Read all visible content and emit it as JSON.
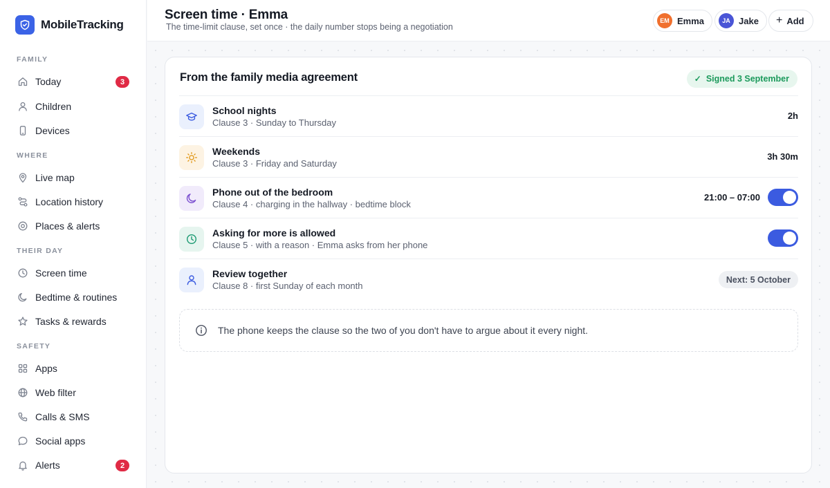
{
  "brand": {
    "name": "MobileTracking"
  },
  "sidebar": {
    "sections": [
      {
        "label": "FAMILY"
      },
      {
        "label": "WHERE"
      },
      {
        "label": "THEIR DAY"
      },
      {
        "label": "SAFETY"
      }
    ],
    "items": [
      {
        "label": "Today",
        "icon": "home-icon",
        "badge": "3"
      },
      {
        "label": "Children",
        "icon": "person-icon"
      },
      {
        "label": "Devices",
        "icon": "phone-icon"
      },
      {
        "label": "Live map",
        "icon": "map-pin-icon"
      },
      {
        "label": "Location history",
        "icon": "route-icon"
      },
      {
        "label": "Places & alerts",
        "icon": "target-icon"
      },
      {
        "label": "Screen time",
        "icon": "clock-icon"
      },
      {
        "label": "Bedtime & routines",
        "icon": "moon-icon"
      },
      {
        "label": "Tasks & rewards",
        "icon": "star-icon"
      },
      {
        "label": "Apps",
        "icon": "grid-icon"
      },
      {
        "label": "Web filter",
        "icon": "globe-icon"
      },
      {
        "label": "Calls & SMS",
        "icon": "phone-call-icon"
      },
      {
        "label": "Social apps",
        "icon": "chat-bubble-icon"
      },
      {
        "label": "Alerts",
        "icon": "bell-icon",
        "badge": "2"
      }
    ]
  },
  "header": {
    "title": "Screen time · Emma",
    "subtitle": "The time-limit clause, set once · the daily number stops being a negotiation",
    "children": [
      {
        "initials": "EM",
        "name": "Emma",
        "color": "#f0702e"
      },
      {
        "initials": "JA",
        "name": "Jake",
        "color": "#4a55d6"
      }
    ],
    "add_label": "Add"
  },
  "card": {
    "title": "From the family media agreement",
    "signed_label": "Signed 3 September",
    "rows": [
      {
        "title": "School nights",
        "sub": "Clause 3 · Sunday to Thursday",
        "value": "2h",
        "icon": "graduation-cap-icon"
      },
      {
        "title": "Weekends",
        "sub": "Clause 3 · Friday and Saturday",
        "value": "3h 30m",
        "icon": "sun-icon"
      },
      {
        "title": "Phone out of the bedroom",
        "sub": "Clause 4 · charging in the hallway · bedtime block",
        "time": "21:00 – 07:00",
        "toggle_on": true,
        "icon": "moon-icon"
      },
      {
        "title": "Asking for more is allowed",
        "sub": "Clause 5 · with a reason · Emma asks from her phone",
        "toggle_on": true,
        "icon": "clock-icon"
      },
      {
        "title": "Review together",
        "sub": "Clause 8 · first Sunday of each month",
        "next": "Next: 5 October",
        "icon": "person-icon"
      }
    ],
    "note": "The phone keeps the clause so the two of you don't have to argue about it every night."
  },
  "colors": {
    "accent": "#3b5be0",
    "brand": "#3b63e6",
    "badge": "#e02a45",
    "success": "#1c9a5c"
  }
}
